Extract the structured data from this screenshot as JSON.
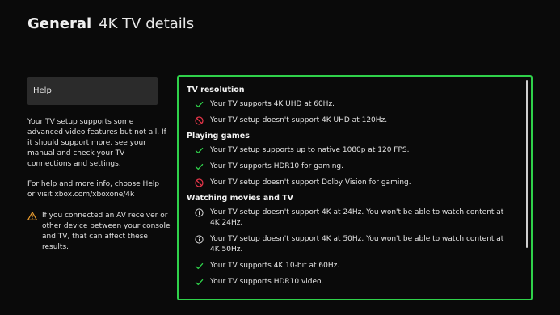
{
  "header": {
    "section": "General",
    "page": "4K TV details"
  },
  "sidebar": {
    "help_label": "Help",
    "description": "Your TV setup supports some advanced video features but not all. If it should support more, see your manual and check your TV connections and settings.",
    "help_info": "For help and more info, choose Help or visit xbox.com/xboxone/4k",
    "warning": "If you connected an AV receiver or other device between your console and TV, that can affect these results."
  },
  "colors": {
    "check": "#2fd14a",
    "unsupported": "#e8364a",
    "info": "#d8d8d8",
    "warning": "#f0a030",
    "focus_border": "#2fd14a"
  },
  "details": {
    "categories": [
      {
        "title": "TV resolution",
        "items": [
          {
            "status": "check-icon",
            "text": "Your TV supports 4K UHD at 60Hz."
          },
          {
            "status": "not-supported-icon",
            "text": "Your TV setup doesn't support 4K UHD at 120Hz."
          }
        ]
      },
      {
        "title": "Playing games",
        "items": [
          {
            "status": "check-icon",
            "text": "Your TV setup supports up to native 1080p at 120 FPS."
          },
          {
            "status": "check-icon",
            "text": "Your TV supports HDR10 for gaming."
          },
          {
            "status": "not-supported-icon",
            "text": "Your TV setup doesn't support Dolby Vision for gaming."
          }
        ]
      },
      {
        "title": "Watching movies and TV",
        "items": [
          {
            "status": "info-icon",
            "text": "Your TV setup doesn't support 4K at 24Hz. You won't be able to watch content at 4K 24Hz."
          },
          {
            "status": "info-icon",
            "text": "Your TV setup doesn't support 4K at 50Hz. You won't be able to watch content at 4K 50Hz."
          },
          {
            "status": "check-icon",
            "text": "Your TV supports 4K 10-bit at 60Hz."
          },
          {
            "status": "check-icon",
            "text": "Your TV supports HDR10 video."
          }
        ]
      }
    ]
  }
}
